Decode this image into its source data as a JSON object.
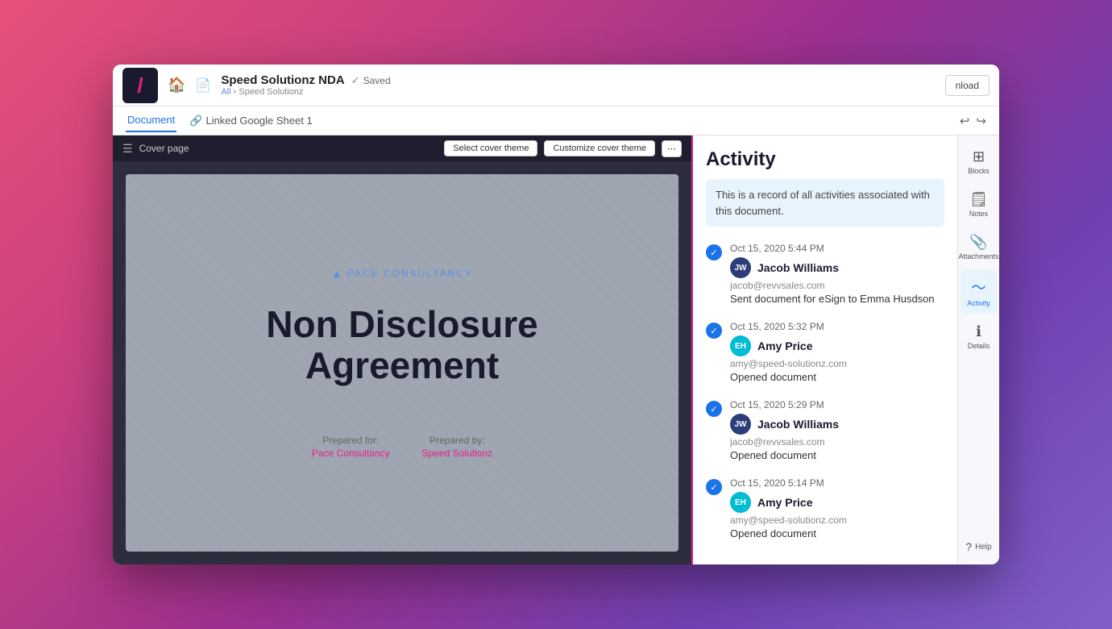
{
  "app": {
    "logo_slash": "/",
    "download_label": "nload"
  },
  "topbar": {
    "doc_icon": "📄",
    "doc_title": "Speed Solutionz NDA",
    "saved_label": "Saved",
    "breadcrumb_all": "All",
    "breadcrumb_sep": "›",
    "breadcrumb_company": "Speed Solutionz"
  },
  "subbar": {
    "tabs": [
      {
        "id": "document",
        "label": "Document",
        "active": true
      },
      {
        "id": "linked-sheet",
        "label": "Linked Google Sheet 1",
        "active": false
      }
    ],
    "undo_icon": "↩",
    "redo_icon": "↪"
  },
  "cover_page": {
    "label": "Cover page",
    "select_theme_btn": "Select cover theme",
    "customize_theme_btn": "Customize cover theme"
  },
  "document": {
    "company_name": "PACE CONSULTANCY",
    "title_line1": "Non Disclosure",
    "title_line2": "Agreement",
    "prepared_for_label": "Prepared for:",
    "prepared_for_value": "Pace Consultancy",
    "prepared_by_label": "Prepared by:",
    "prepared_by_value": "Speed Solutionz"
  },
  "activity": {
    "title": "Activity",
    "info_text": "This is a record of all activities associated with this document.",
    "items": [
      {
        "time": "Oct 15, 2020 5:44 PM",
        "avatar_initials": "JW",
        "avatar_class": "avatar-jw",
        "user_name": "Jacob Williams",
        "email": "jacob@revvsales.com",
        "action": "Sent document for eSign to Emma Husdson"
      },
      {
        "time": "Oct 15, 2020 5:32 PM",
        "avatar_initials": "EH",
        "avatar_class": "avatar-eh",
        "user_name": "Amy Price",
        "email": "amy@speed-solutionz.com",
        "action": "Opened document"
      },
      {
        "time": "Oct 15, 2020 5:29 PM",
        "avatar_initials": "JW",
        "avatar_class": "avatar-jw",
        "user_name": "Jacob Williams",
        "email": "jacob@revvsales.com",
        "action": "Opened document"
      },
      {
        "time": "Oct 15, 2020 5:14 PM",
        "avatar_initials": "EH",
        "avatar_class": "avatar-eh",
        "user_name": "Amy Price",
        "email": "amy@speed-solutionz.com",
        "action": "Opened document"
      }
    ]
  },
  "right_sidebar": {
    "items": [
      {
        "id": "blocks",
        "icon": "⊞",
        "label": "Blocks"
      },
      {
        "id": "notes",
        "icon": "🗒",
        "label": "Notes"
      },
      {
        "id": "attachments",
        "icon": "📎",
        "label": "Attachments"
      },
      {
        "id": "activity",
        "icon": "〜",
        "label": "Activity",
        "active": true
      },
      {
        "id": "details",
        "icon": "ℹ",
        "label": "Details"
      }
    ],
    "help_label": "Help"
  }
}
